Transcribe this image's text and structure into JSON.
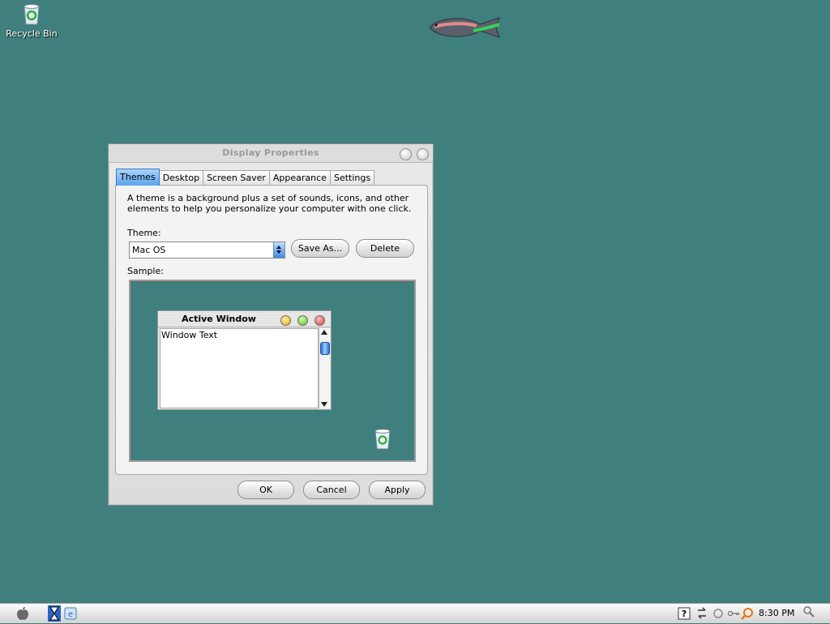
{
  "desktop": {
    "icons": [
      {
        "label": "Recycle Bin",
        "icon": "recycle-bin-icon"
      }
    ],
    "background_color": "#3f7f7e",
    "wallpaper_fish": "fish-icon"
  },
  "dialog": {
    "title": "Display Properties",
    "tabs": [
      {
        "label": "Themes",
        "active": true
      },
      {
        "label": "Desktop"
      },
      {
        "label": "Screen Saver"
      },
      {
        "label": "Appearance"
      },
      {
        "label": "Settings"
      }
    ],
    "description": "A theme is a background plus a set of sounds, icons, and other elements to help you personalize your computer with one click.",
    "theme_label": "Theme:",
    "theme_value": "Mac OS",
    "save_as_label": "Save As...",
    "delete_label": "Delete",
    "sample_label": "Sample:",
    "sample": {
      "window_title": "Active Window",
      "window_text": "Window Text"
    },
    "ok_label": "OK",
    "cancel_label": "Cancel",
    "apply_label": "Apply"
  },
  "taskbar": {
    "start_icon": "apple-icon",
    "clock": "8:30 PM"
  }
}
